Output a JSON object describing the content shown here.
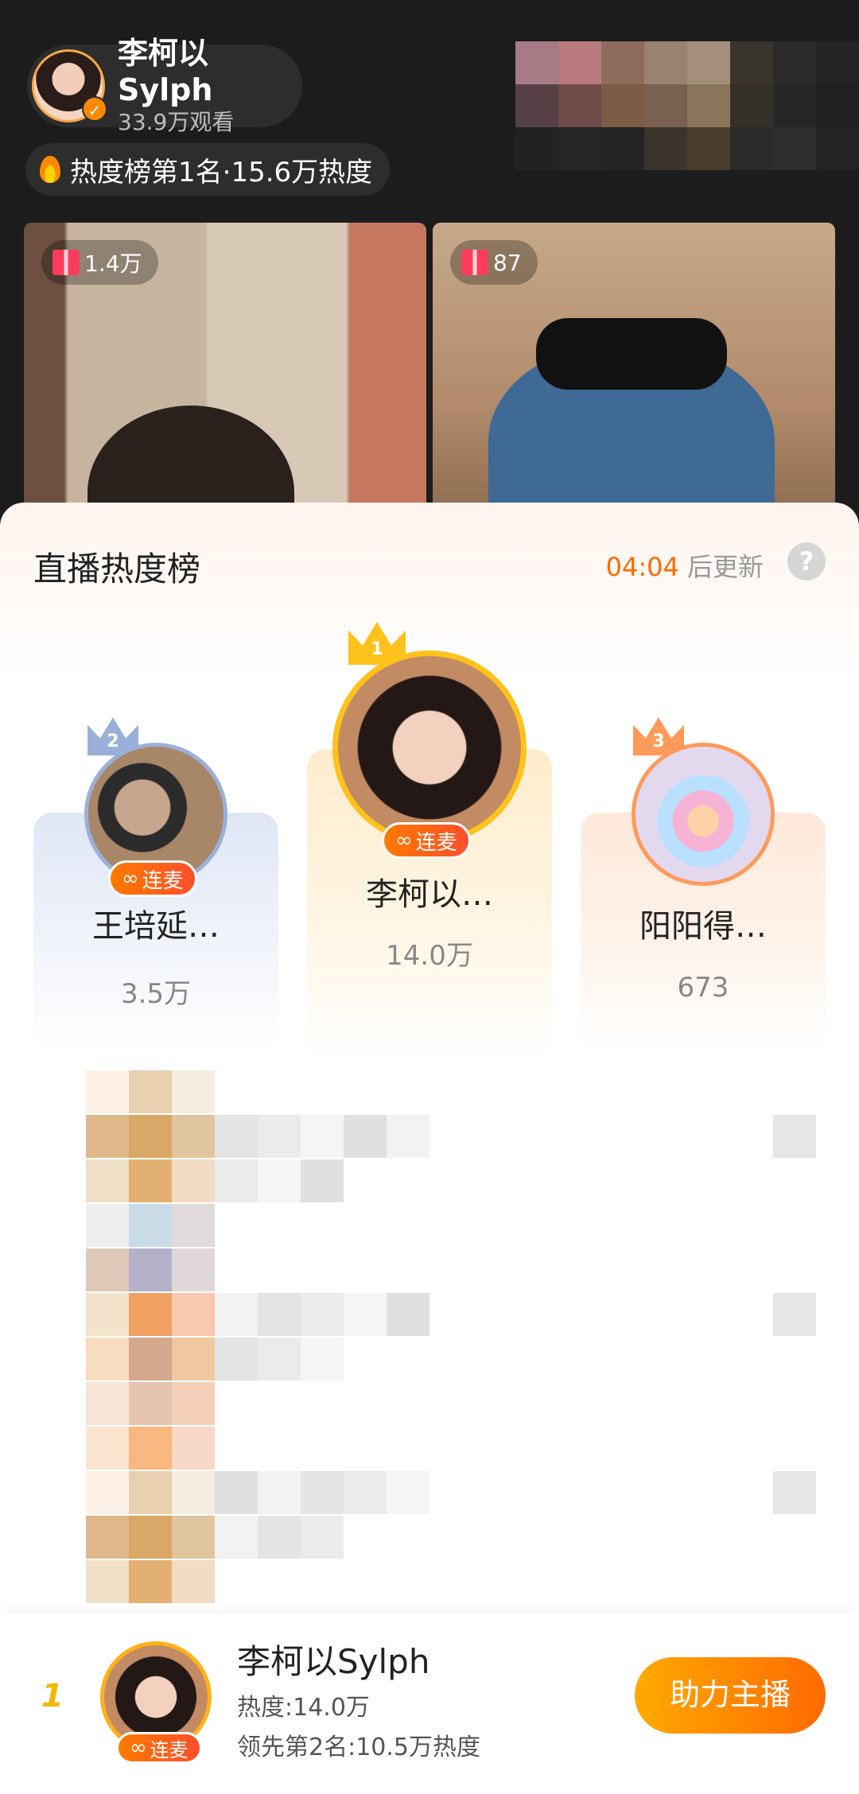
{
  "host": {
    "name": "李柯以Sylph",
    "views": "33.9万观看"
  },
  "heat_badge": "热度榜第1名·15.6万热度",
  "videos": [
    {
      "gift_count": "1.4万"
    },
    {
      "gift_count": "87"
    }
  ],
  "sheet": {
    "title": "直播热度榜",
    "update_time": "04:04",
    "update_suffix": " 后更新",
    "help": "?"
  },
  "top3": [
    {
      "rank": "1",
      "name": "李柯以…",
      "score": "14.0万",
      "tag": "连麦"
    },
    {
      "rank": "2",
      "name": "王培延…",
      "score": "3.5万",
      "tag": "连麦"
    },
    {
      "rank": "3",
      "name": "阳阳得…",
      "score": "673"
    }
  ],
  "my_rank": {
    "rank": "1",
    "name": "李柯以Sylph",
    "tag": "连麦",
    "heat": "热度:14.0万",
    "lead": "领先第2名:10.5万热度",
    "button": "助力主播"
  },
  "colors": {
    "accent": "#ff6a00",
    "gold": "#ffc21a",
    "silver": "#9ab0d8",
    "bronze": "#ff9a5a"
  }
}
